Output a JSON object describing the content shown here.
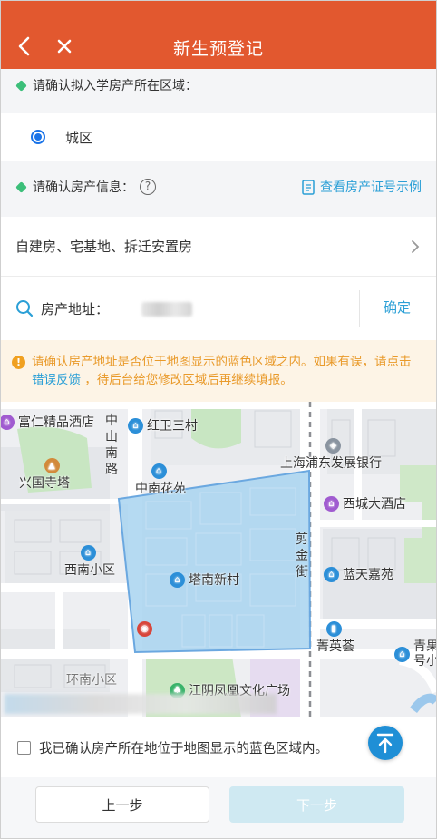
{
  "header": {
    "title": "新生预登记",
    "back_icon": "chevron-left-icon",
    "close_icon": "close-icon",
    "bg_color": "#e2582f"
  },
  "area_section": {
    "label": "请确认拟入学房产所在区域：",
    "options": [
      {
        "label": "城区",
        "selected": true
      }
    ]
  },
  "property_section": {
    "label": "请确认房产信息：",
    "help_icon": "?",
    "cert_link": "查看房产证号示例",
    "type_value": "自建房、宅基地、拆迁安置房",
    "address_label": "房产地址：",
    "confirm_label": "确定"
  },
  "notice": {
    "text_before": "请确认房产地址是否位于地图显示的蓝色区域之内。如果有误，请点击",
    "link_text": "错误反馈",
    "text_after": "，待后台给您修改区域后再继续填报。"
  },
  "map": {
    "labels": {
      "furen_hotel": "富仁精品酒店",
      "zhongshan_road": "中山南路",
      "hongwei_village": "红卫三村",
      "xingguo_pagoda": "兴国寺塔",
      "spdb": "上海浦东发展银行",
      "zhongnan_garden": "中南花苑",
      "xicheng_hotel": "西城大酒店",
      "xinan_district": "西南小区",
      "tanan_village": "塔南新村",
      "jianjin_street": "剪金街",
      "lantian_garden": "蓝天嘉苑",
      "jingying_hui": "菁英荟",
      "qingguo": "青果号小",
      "huannan_district": "环南小区",
      "fenghuang_plaza": "江阴凤凰文化广场"
    },
    "highlight_color": "#a8d4f0"
  },
  "footer": {
    "agree_text": "我已确认房产所在地位于地图显示的蓝色区域内。",
    "prev_label": "上一步",
    "next_label": "下一步",
    "next_color": "#cfe9f2"
  }
}
